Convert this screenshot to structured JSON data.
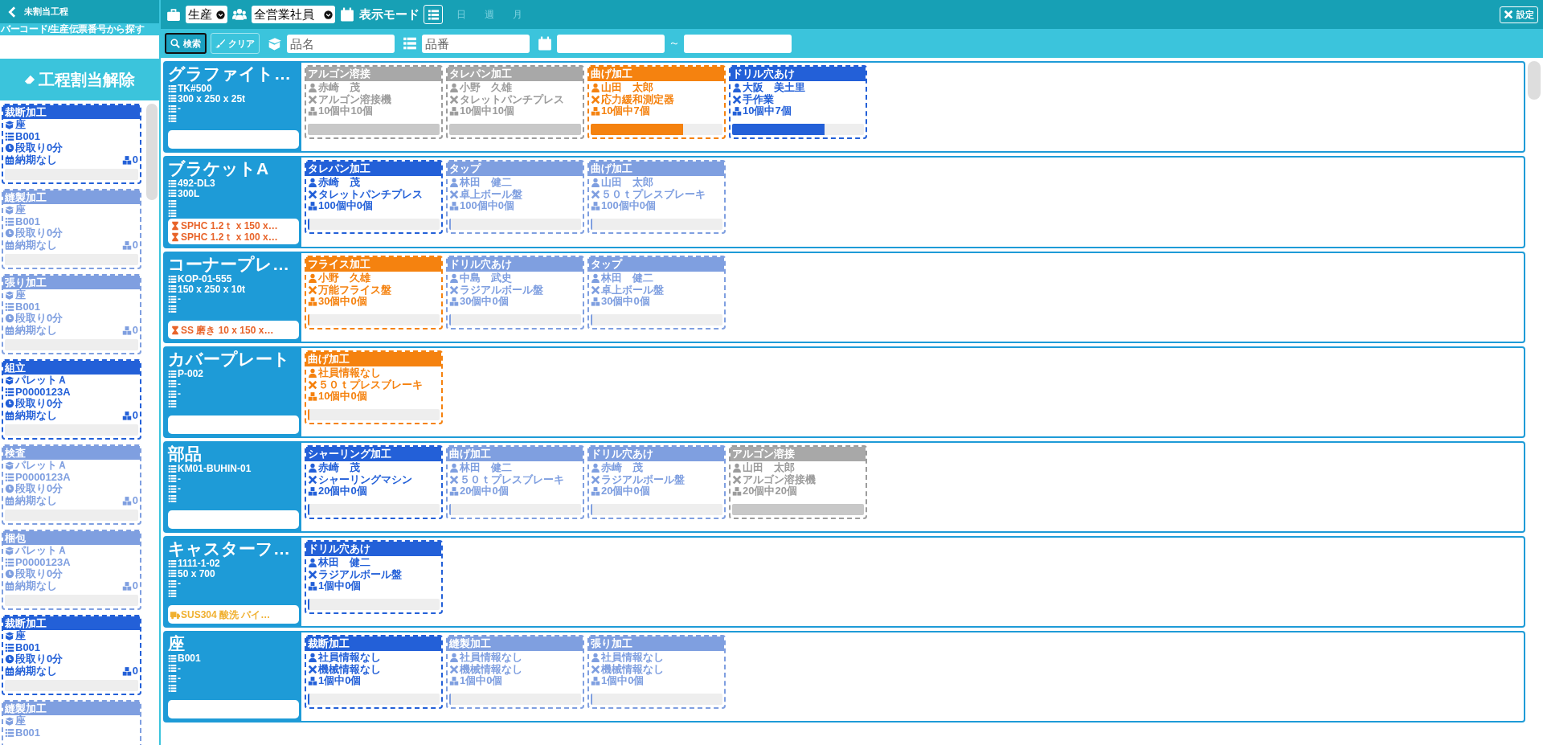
{
  "sidebar": {
    "title": "未割当工程",
    "search_label": "バーコード/生産伝票番号から探す",
    "unassign_button": "工程割当解除",
    "cards": [
      {
        "process": "裁断加工",
        "kind": "assigned",
        "product": "座",
        "code": "B001",
        "setup": "段取り0分",
        "due": "納期なし",
        "count": "0"
      },
      {
        "process": "縫製加工",
        "kind": "pending",
        "product": "座",
        "code": "B001",
        "setup": "段取り0分",
        "due": "納期なし",
        "count": "0"
      },
      {
        "process": "張り加工",
        "kind": "pending",
        "product": "座",
        "code": "B001",
        "setup": "段取り0分",
        "due": "納期なし",
        "count": "0"
      },
      {
        "process": "組立",
        "kind": "assigned",
        "product": "パレットＡ",
        "code": "P0000123A",
        "setup": "段取り0分",
        "due": "納期なし",
        "count": "0"
      },
      {
        "process": "検査",
        "kind": "pending",
        "product": "パレットＡ",
        "code": "P0000123A",
        "setup": "段取り0分",
        "due": "納期なし",
        "count": "0"
      },
      {
        "process": "梱包",
        "kind": "pending",
        "product": "パレットＡ",
        "code": "P0000123A",
        "setup": "段取り0分",
        "due": "納期なし",
        "count": "0"
      },
      {
        "process": "裁断加工",
        "kind": "assigned",
        "product": "座",
        "code": "B001",
        "setup": "段取り0分",
        "due": "納期なし",
        "count": "0"
      },
      {
        "process": "縫製加工",
        "kind": "pending",
        "product": "座",
        "code": "B001"
      }
    ]
  },
  "toolbar": {
    "category": "生産",
    "staff": "全営業社員",
    "view_mode_label": "表示モード",
    "view_modes": [
      {
        "kind": "list",
        "selected": true
      },
      {
        "kind": "text",
        "label": "日",
        "selected": false
      },
      {
        "kind": "text",
        "label": "週",
        "selected": false
      },
      {
        "kind": "text",
        "label": "月",
        "selected": false
      }
    ],
    "settings_button": "設定"
  },
  "filter_bar": {
    "search_button": "検索",
    "clear_button": "クリア",
    "name_placeholder": "品名",
    "number_placeholder": "品番",
    "range_separator": "～"
  },
  "products": [
    {
      "name": "グラファイト…",
      "specs": [
        "TK#500",
        "300 x 250 x 25t",
        "-"
      ],
      "processes": [
        {
          "title": "アルゴン溶接",
          "kind": "done",
          "worker": "赤崎　茂",
          "machine": "アルゴン溶接機",
          "quantity": "10個中10個",
          "level": 1
        },
        {
          "title": "タレパン加工",
          "kind": "done",
          "worker": "小野　久雄",
          "machine": "タレットパンチプレス",
          "quantity": "10個中10個",
          "level": 1
        },
        {
          "title": "曲げ加工",
          "kind": "active",
          "worker": "山田　太郎",
          "machine": "応力緩和測定器",
          "quantity": "10個中7個",
          "level": 0.7
        },
        {
          "title": "ドリル穴あけ",
          "kind": "assigned",
          "worker": "大阪　美土里",
          "machine": "手作業",
          "quantity": "10個中7個",
          "level": 0.7
        }
      ]
    },
    {
      "name": "ブラケットA",
      "specs": [
        "492-DL3",
        "300L"
      ],
      "materials": [
        {
          "kind": "hourglass",
          "text": "SPHC 1.2ｔ x 150 x…"
        },
        {
          "kind": "hourglass",
          "text": "SPHC 1.2ｔ x 100 x…"
        }
      ],
      "processes": [
        {
          "title": "タレパン加工",
          "kind": "assigned",
          "worker": "赤崎　茂",
          "machine": "タレットパンチプレス",
          "quantity": "100個中0個",
          "level": 0
        },
        {
          "title": "タップ",
          "kind": "pending",
          "worker": "林田　健二",
          "machine": "卓上ボール盤",
          "quantity": "100個中0個",
          "level": 0
        },
        {
          "title": "曲げ加工",
          "kind": "pending",
          "worker": "山田　太郎",
          "machine": "５０ｔプレスブレーキ",
          "quantity": "100個中0個",
          "level": 0
        }
      ]
    },
    {
      "name": "コーナープレ…",
      "specs": [
        "KOP-01-555",
        "150 x 250 x 10t",
        "-"
      ],
      "materials": [
        {
          "kind": "hourglass",
          "text": "SS 磨き 10 x 150 x…"
        }
      ],
      "processes": [
        {
          "title": "フライス加工",
          "kind": "active",
          "worker": "小野　久雄",
          "machine": "万能フライス盤",
          "quantity": "30個中0個",
          "level": 0
        },
        {
          "title": "ドリル穴あけ",
          "kind": "pending",
          "worker": "中島　武史",
          "machine": "ラジアルボール盤",
          "quantity": "30個中0個",
          "level": 0
        },
        {
          "title": "タップ",
          "kind": "pending",
          "worker": "林田　健二",
          "machine": "卓上ボール盤",
          "quantity": "30個中0個",
          "level": 0
        }
      ]
    },
    {
      "name": "カバープレート",
      "specs": [
        "P-002",
        "-",
        "-"
      ],
      "processes": [
        {
          "title": "曲げ加工",
          "kind": "active",
          "worker": "社員情報なし",
          "machine": "５０ｔプレスブレーキ",
          "quantity": "10個中0個",
          "level": 0
        }
      ]
    },
    {
      "name": "部品",
      "specs": [
        "KM01-BUHIN-01",
        "-",
        "-"
      ],
      "processes": [
        {
          "title": "シャーリング加工",
          "kind": "assigned",
          "worker": "赤崎　茂",
          "machine": "シャーリングマシン",
          "quantity": "20個中0個",
          "level": 0
        },
        {
          "title": "曲げ加工",
          "kind": "pending",
          "worker": "林田　健二",
          "machine": "５０ｔプレスブレーキ",
          "quantity": "20個中0個",
          "level": 0
        },
        {
          "title": "ドリル穴あけ",
          "kind": "pending",
          "worker": "赤崎　茂",
          "machine": "ラジアルボール盤",
          "quantity": "20個中0個",
          "level": 0
        },
        {
          "title": "アルゴン溶接",
          "kind": "done",
          "worker": "山田　太郎",
          "machine": "アルゴン溶接機",
          "quantity": "20個中20個",
          "level": 1
        }
      ]
    },
    {
      "name": "キャスターフ…",
      "specs": [
        "1111-1-02",
        "50 x 700",
        "-"
      ],
      "materials": [
        {
          "kind": "truck",
          "text": "SUS304 酸洗 パイ…"
        }
      ],
      "processes": [
        {
          "title": "ドリル穴あけ",
          "kind": "assigned",
          "worker": "林田　健二",
          "machine": "ラジアルボール盤",
          "quantity": "1個中0個",
          "level": 0
        }
      ]
    },
    {
      "name": "座",
      "specs": [
        "B001",
        "-",
        "-"
      ],
      "processes": [
        {
          "title": "裁断加工",
          "kind": "assigned",
          "worker": "社員情報なし",
          "machine": "機械情報なし",
          "quantity": "1個中0個",
          "level": 0
        },
        {
          "title": "縫製加工",
          "kind": "pending",
          "worker": "社員情報なし",
          "machine": "機械情報なし",
          "quantity": "1個中0個",
          "level": 0
        },
        {
          "title": "張り加工",
          "kind": "pending",
          "worker": "社員情報なし",
          "machine": "機械情報なし",
          "quantity": "1個中0個",
          "level": 0
        }
      ]
    }
  ]
}
